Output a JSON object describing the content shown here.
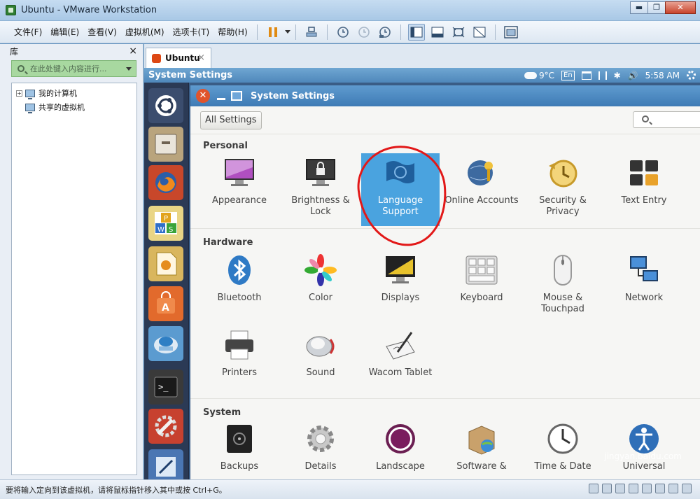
{
  "window": {
    "title": "Ubuntu - VMware Workstation",
    "min": "▬",
    "max": "❐",
    "close": "✕"
  },
  "menu": [
    "文件(F)",
    "编辑(E)",
    "查看(V)",
    "虚拟机(M)",
    "选项卡(T)",
    "帮助(H)"
  ],
  "library": {
    "title": "库",
    "close": "×",
    "search_placeholder": "在此处键入内容进行...",
    "tree": [
      {
        "label": "我的计算机",
        "expand": "+"
      },
      {
        "label": "共享的虚拟机"
      }
    ]
  },
  "tab": {
    "label": "Ubuntu",
    "close": "×"
  },
  "ubuntu": {
    "panel_title": "System Settings",
    "weather": "9°C",
    "keyboard": "En",
    "bluetooth": "✱",
    "volume": "🔊",
    "time": "5:58 AM",
    "tooltip": "wps"
  },
  "settings": {
    "window_title": "System Settings",
    "close": "✕",
    "all_settings": "All Settings",
    "sections": {
      "personal": "Personal",
      "hardware": "Hardware",
      "system": "System"
    },
    "personal_items": [
      "Appearance",
      "Brightness & Lock",
      "Language Support",
      "Online Accounts",
      "Security & Privacy",
      "Text Entry"
    ],
    "hardware_items": [
      "Bluetooth",
      "Color",
      "Displays",
      "Keyboard",
      "Mouse & Touchpad",
      "Network",
      "Printers",
      "Sound",
      "Wacom Tablet"
    ],
    "system_items": [
      "Backups",
      "Details",
      "Landscape",
      "Software &",
      "Time & Date",
      "Universal"
    ]
  },
  "watermark": "jingyan.baidu.com",
  "status": {
    "text": "要将输入定向到该虚拟机，请将鼠标指针移入其中或按 Ctrl+G。"
  },
  "colors": {
    "accent": "#4aa3df",
    "highlight_circle": "#e21818",
    "launcher": "#2b3a55"
  }
}
